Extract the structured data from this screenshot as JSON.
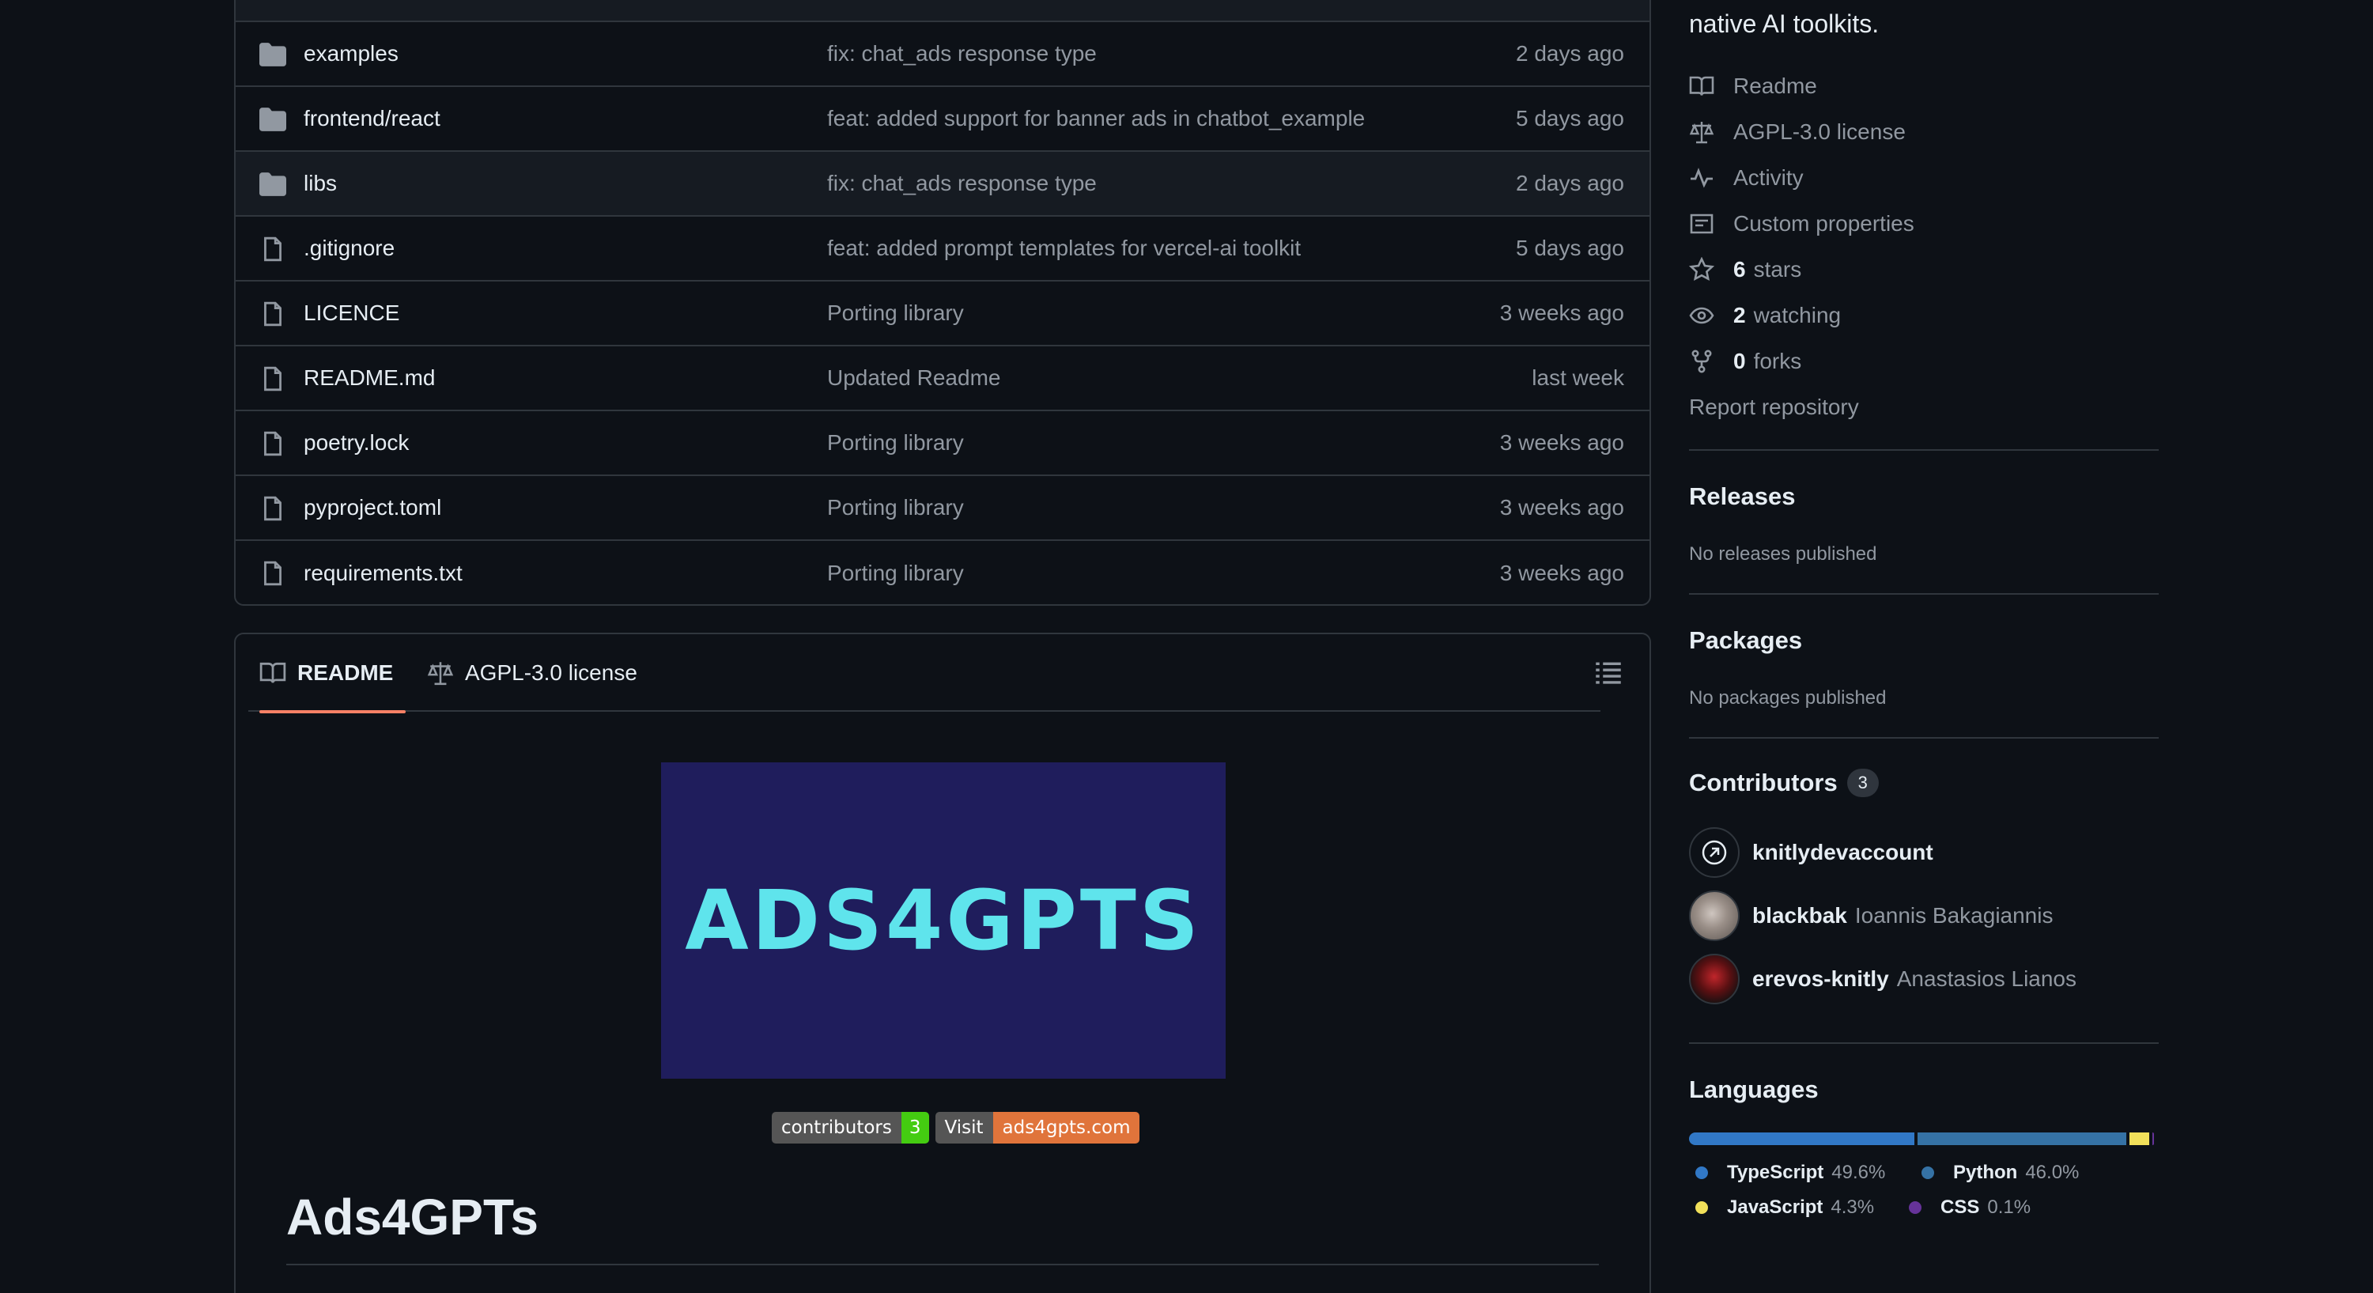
{
  "files": {
    "rows": [
      {
        "name": "examples",
        "type": "folder",
        "message": "fix: chat_ads response type",
        "time": "2 days ago"
      },
      {
        "name": "frontend/react",
        "type": "folder",
        "message": "feat: added support for banner ads in chatbot_example",
        "time": "5 days ago"
      },
      {
        "name": "libs",
        "type": "folder",
        "message": "fix: chat_ads response type",
        "time": "2 days ago"
      },
      {
        "name": ".gitignore",
        "type": "file",
        "message": "feat: added prompt templates for vercel-ai toolkit",
        "time": "5 days ago"
      },
      {
        "name": "LICENCE",
        "type": "file",
        "message": "Porting library",
        "time": "3 weeks ago"
      },
      {
        "name": "README.md",
        "type": "file",
        "message": "Updated Readme",
        "time": "last week"
      },
      {
        "name": "poetry.lock",
        "type": "file",
        "message": "Porting library",
        "time": "3 weeks ago"
      },
      {
        "name": "pyproject.toml",
        "type": "file",
        "message": "Porting library",
        "time": "3 weeks ago"
      },
      {
        "name": "requirements.txt",
        "type": "file",
        "message": "Porting library",
        "time": "3 weeks ago"
      }
    ]
  },
  "readme": {
    "tabs": {
      "readme": "README",
      "license": "AGPL-3.0 license"
    },
    "banner_text": "ADS4GPTS",
    "badges": {
      "contributors_label": "contributors",
      "contributors_count": "3",
      "visit_label": "Visit",
      "visit_value": "ads4gpts.com"
    },
    "heading": "Ads4GPTs"
  },
  "sidebar": {
    "about_desc": "native AI toolkits.",
    "links": {
      "readme": "Readme",
      "license": "AGPL-3.0 license",
      "activity": "Activity",
      "custom_properties": "Custom properties",
      "stars_count": "6",
      "stars_label": "stars",
      "watching_count": "2",
      "watching_label": "watching",
      "forks_count": "0",
      "forks_label": "forks",
      "report": "Report repository"
    },
    "releases": {
      "title": "Releases",
      "note": "No releases published"
    },
    "packages": {
      "title": "Packages",
      "note": "No packages published"
    },
    "contributors": {
      "title": "Contributors",
      "count": "3",
      "list": [
        {
          "login": "knitlydevaccount",
          "full": ""
        },
        {
          "login": "blackbak",
          "full": "Ioannis Bakagiannis"
        },
        {
          "login": "erevos-knitly",
          "full": "Anastasios Lianos"
        }
      ]
    },
    "languages": {
      "title": "Languages",
      "list": [
        {
          "name": "TypeScript",
          "pct": "49.6%",
          "value": 49.6,
          "color": "#3178c6"
        },
        {
          "name": "Python",
          "pct": "46.0%",
          "value": 46.0,
          "color": "#3572A5"
        },
        {
          "name": "JavaScript",
          "pct": "4.3%",
          "value": 4.3,
          "color": "#f1e05a"
        },
        {
          "name": "CSS",
          "pct": "0.1%",
          "value": 0.1,
          "color": "#663399"
        }
      ]
    }
  },
  "colors": {
    "accent_tab": "#f78166",
    "background": "#0d1117",
    "muted": "#9198a1"
  }
}
